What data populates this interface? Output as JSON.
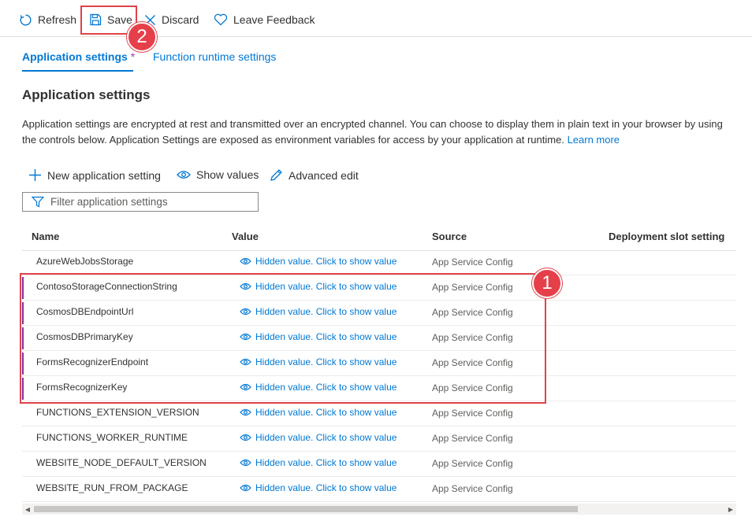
{
  "toolbar": {
    "refresh": "Refresh",
    "save": "Save",
    "discard": "Discard",
    "feedback": "Leave Feedback"
  },
  "tabs": [
    {
      "label": "Application settings",
      "dirty_mark": "*"
    },
    {
      "label": "Function runtime settings"
    }
  ],
  "section": {
    "title": "Application settings",
    "description": "Application settings are encrypted at rest and transmitted over an encrypted channel. You can choose to display them in plain text in your browser by using the controls below. Application Settings are exposed as environment variables for access by your application at runtime.",
    "learn_more": "Learn more"
  },
  "commands": {
    "new": "New application setting",
    "show": "Show values",
    "advanced": "Advanced edit"
  },
  "filter": {
    "placeholder": "Filter application settings"
  },
  "table": {
    "columns": [
      "Name",
      "Value",
      "Source",
      "Deployment slot setting"
    ],
    "rows": [
      {
        "name": "AzureWebJobsStorage",
        "value": "Hidden value. Click to show value",
        "source": "App Service Config",
        "dirty": false
      },
      {
        "name": "ContosoStorageConnectionString",
        "value": "Hidden value. Click to show value",
        "source": "App Service Config",
        "dirty": true
      },
      {
        "name": "CosmosDBEndpointUrl",
        "value": "Hidden value. Click to show value",
        "source": "App Service Config",
        "dirty": true
      },
      {
        "name": "CosmosDBPrimaryKey",
        "value": "Hidden value. Click to show value",
        "source": "App Service Config",
        "dirty": true
      },
      {
        "name": "FormsRecognizerEndpoint",
        "value": "Hidden value. Click to show value",
        "source": "App Service Config",
        "dirty": true
      },
      {
        "name": "FormsRecognizerKey",
        "value": "Hidden value. Click to show value",
        "source": "App Service Config",
        "dirty": true
      },
      {
        "name": "FUNCTIONS_EXTENSION_VERSION",
        "value": "Hidden value. Click to show value",
        "source": "App Service Config",
        "dirty": false
      },
      {
        "name": "FUNCTIONS_WORKER_RUNTIME",
        "value": "Hidden value. Click to show value",
        "source": "App Service Config",
        "dirty": false
      },
      {
        "name": "WEBSITE_NODE_DEFAULT_VERSION",
        "value": "Hidden value. Click to show value",
        "source": "App Service Config",
        "dirty": false
      },
      {
        "name": "WEBSITE_RUN_FROM_PACKAGE",
        "value": "Hidden value. Click to show value",
        "source": "App Service Config",
        "dirty": false
      }
    ]
  },
  "annotations": {
    "badge_1": "1",
    "badge_2": "2"
  },
  "colors": {
    "accent": "#0078d4",
    "callout": "#e5404a",
    "dirty_marker": "#8a2b9b"
  }
}
